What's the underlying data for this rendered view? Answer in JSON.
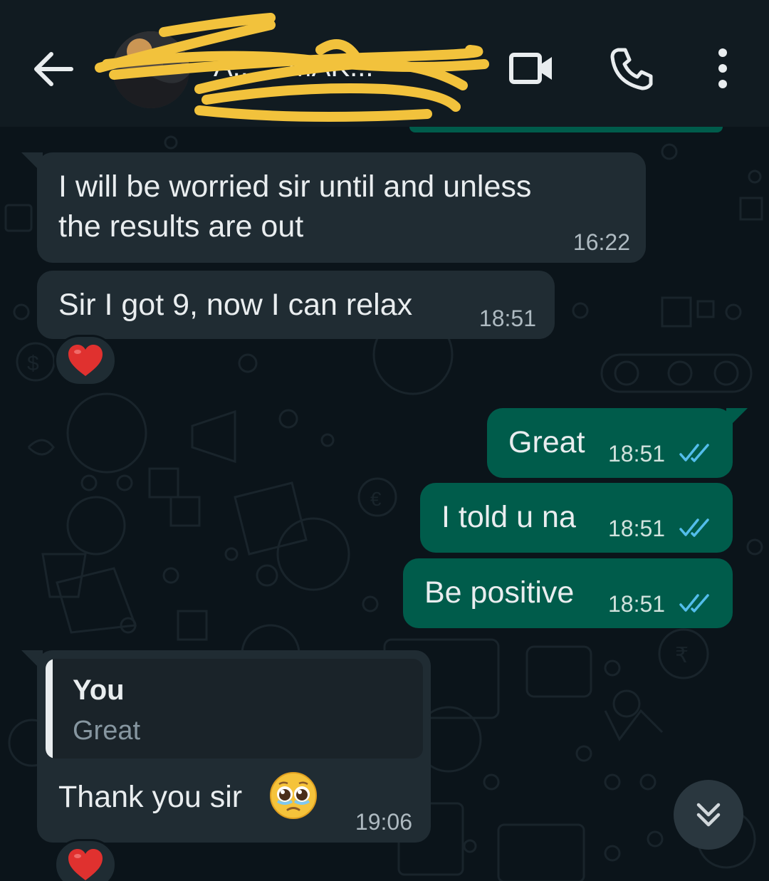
{
  "header": {
    "contact_name": "A... ...MAK...",
    "icons": {
      "back": "arrow-left-icon",
      "video": "video-call-icon",
      "call": "phone-icon",
      "menu": "more-vertical-icon"
    }
  },
  "messages": [
    {
      "direction": "incoming",
      "text_line1": "I will be worried sir until and unless",
      "text_line2": "the results are out",
      "time": "16:22"
    },
    {
      "direction": "incoming",
      "text": "Sir I got 9, now I can relax",
      "time": "18:51",
      "reaction": "❤️"
    },
    {
      "direction": "outgoing",
      "text": "Great",
      "time": "18:51",
      "status": "read"
    },
    {
      "direction": "outgoing",
      "text": "I told u na",
      "time": "18:51",
      "status": "read"
    },
    {
      "direction": "outgoing",
      "text": "Be positive",
      "time": "18:51",
      "status": "read"
    },
    {
      "direction": "incoming",
      "quote_author": "You",
      "quote_text": "Great",
      "text": "Thank you sir",
      "emoji": "🥹",
      "time": "19:06",
      "reaction": "❤️"
    }
  ],
  "colors": {
    "background": "#0b141a",
    "header": "#111b21",
    "incoming_bubble": "#202c33",
    "outgoing_bubble": "#005c4b",
    "read_ticks": "#53bdeb",
    "heart": "#e0312f"
  }
}
